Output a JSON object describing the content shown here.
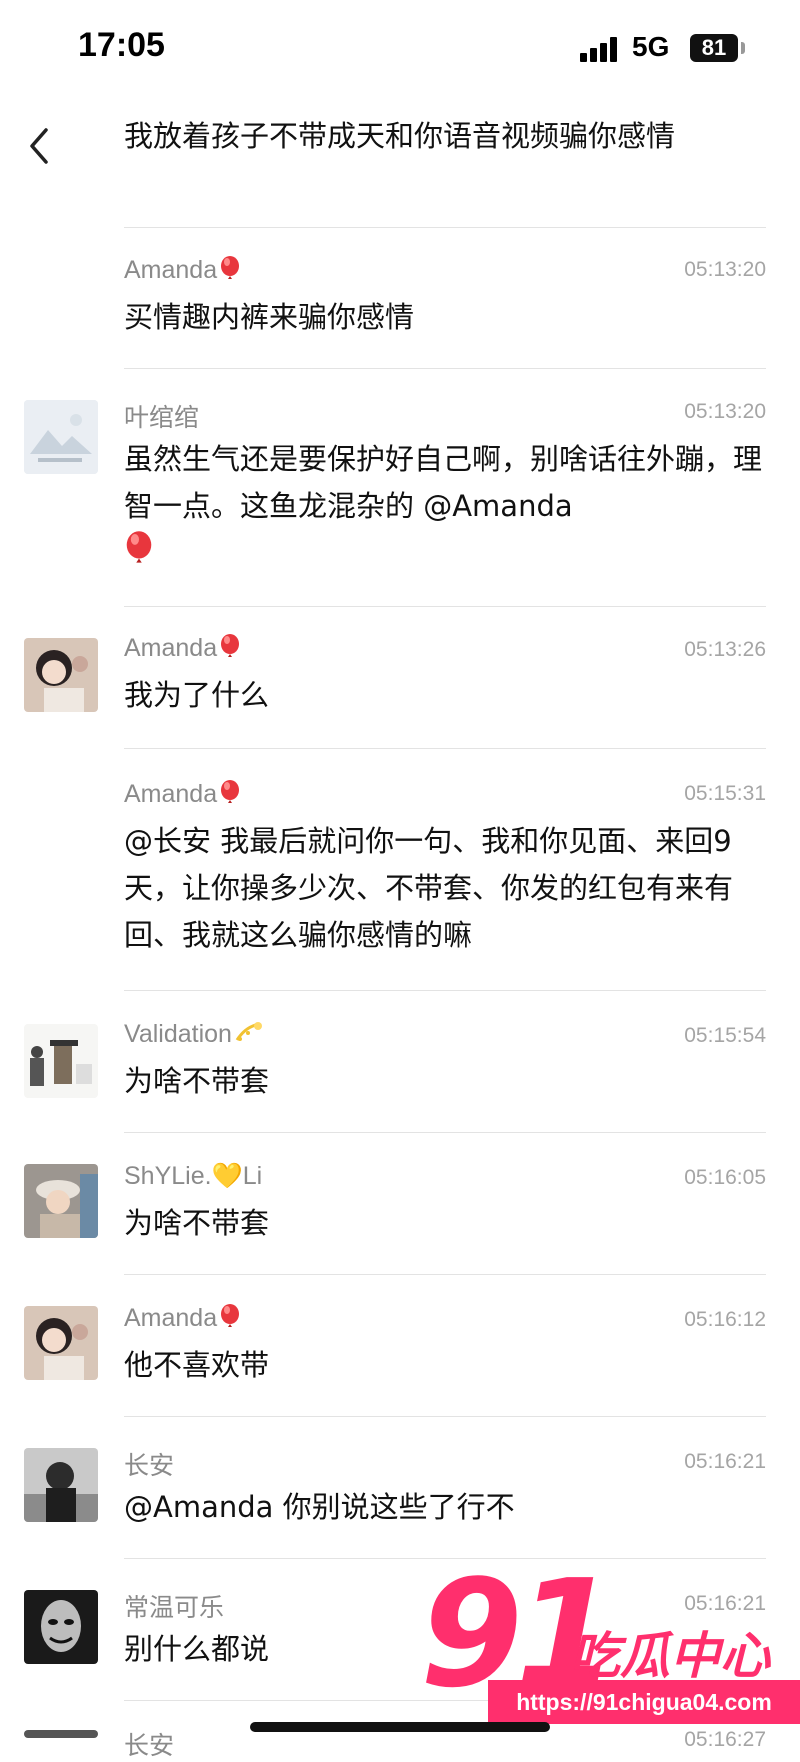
{
  "status_bar": {
    "time": "17:05",
    "network": "5G",
    "battery": "81"
  },
  "header": {
    "title": "我放着孩子不带成天和你语音视频骗你感情"
  },
  "messages": [
    {
      "sender": "Amanda",
      "time": "05:13:20",
      "text": "买情趣内裤来骗你感情",
      "avatar": "none"
    },
    {
      "sender": "叶绾绾",
      "time": "05:13:20",
      "text": "虽然生气还是要保护好自己啊，别啥话往外蹦，理智一点。这鱼龙混杂的 @Amanda",
      "avatar": "landscape-placeholder"
    },
    {
      "sender": "Amanda",
      "time": "05:13:26",
      "text": "我为了什么",
      "avatar": "doll"
    },
    {
      "sender": "Amanda",
      "time": "05:15:31",
      "text": "@长安 我最后就问你一句、我和你见面、来回9天，让你操多少次、不带套、你发的红包有来有回、我就这么骗你感情的嘛",
      "avatar": "none"
    },
    {
      "sender": "Validation",
      "time": "05:15:54",
      "text": "为啥不带套",
      "avatar": "figure"
    },
    {
      "sender": "ShYLie.💛Li",
      "time": "05:16:05",
      "text": "为啥不带套",
      "avatar": "girl-hat"
    },
    {
      "sender": "Amanda",
      "time": "05:16:12",
      "text": "他不喜欢带",
      "avatar": "doll"
    },
    {
      "sender": "长安",
      "time": "05:16:21",
      "text": "@Amanda 你别说这些了行不",
      "avatar": "man-bw"
    },
    {
      "sender": "常温可乐",
      "time": "05:16:21",
      "text": "别什么都说",
      "avatar": "mask"
    },
    {
      "sender": "长安",
      "time": "05:16:27",
      "text": "",
      "avatar": "partial"
    }
  ],
  "watermark": {
    "number": "91",
    "name": "吃瓜中心",
    "url": "https://91chigua04.com"
  },
  "icons": {
    "back": "chevron-left-icon",
    "balloon": "balloon-emoji-icon",
    "sparkle": "sparkle-emoji-icon"
  },
  "colors": {
    "accent": "#ff2f6d",
    "sender": "#8a8a8a",
    "time": "#a5a5a5",
    "balloon": "#e8363d"
  }
}
